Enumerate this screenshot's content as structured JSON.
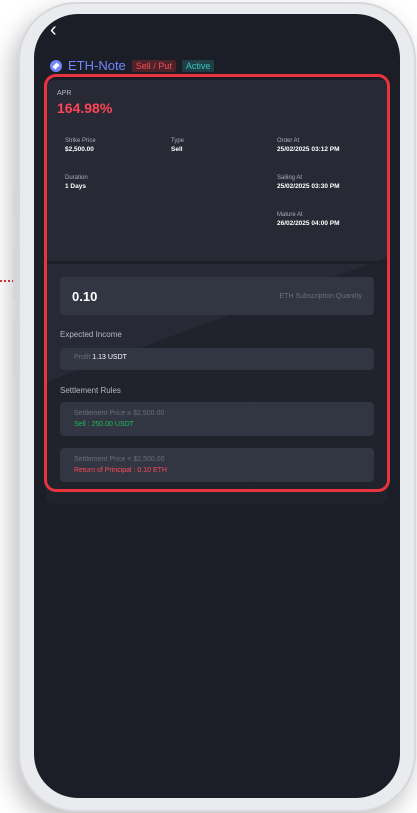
{
  "header": {
    "back_icon": "chevron-left-icon",
    "title": "ETH-Note",
    "badge_type": "Sell / Put",
    "badge_status": "Active"
  },
  "apr": {
    "label": "APR",
    "value": "164.98%"
  },
  "details": {
    "strike_price": {
      "label": "Strike Price",
      "value": "$2,500.00"
    },
    "type": {
      "label": "Type",
      "value": "Sell"
    },
    "order_at": {
      "label": "Order At",
      "value": "25/02/2025 03:12 PM"
    },
    "duration": {
      "label": "Duration",
      "value": "1 Days"
    },
    "sailing_at": {
      "label": "Sailing At",
      "value": "25/02/2025 03:30 PM"
    },
    "mature_at": {
      "label": "Mature At",
      "value": "26/02/2025 04:00 PM"
    }
  },
  "subscription": {
    "quantity": "0.10",
    "unit_label": "ETH Subscription Quantity"
  },
  "expected_income": {
    "label": "Expected Income",
    "profit_label": "Profit",
    "profit_value": "1.13 USDT"
  },
  "settlement": {
    "label": "Settlement Rules",
    "rules": [
      {
        "condition": "Settlement Price ≥ $2,500.00",
        "result": "Sell : 250.00 USDT"
      },
      {
        "condition": "Settlement Price < $2,500.00",
        "result": "Return of Principal : 0.10 ETH"
      }
    ]
  },
  "colors": {
    "accent": "#6f86ff",
    "apr": "#ff4454",
    "positive": "#1fba5a",
    "negative": "#ff4b55",
    "highlight_border": "#e9343e",
    "screen_bg": "#1b1e27",
    "card_bg": "#272a35"
  }
}
